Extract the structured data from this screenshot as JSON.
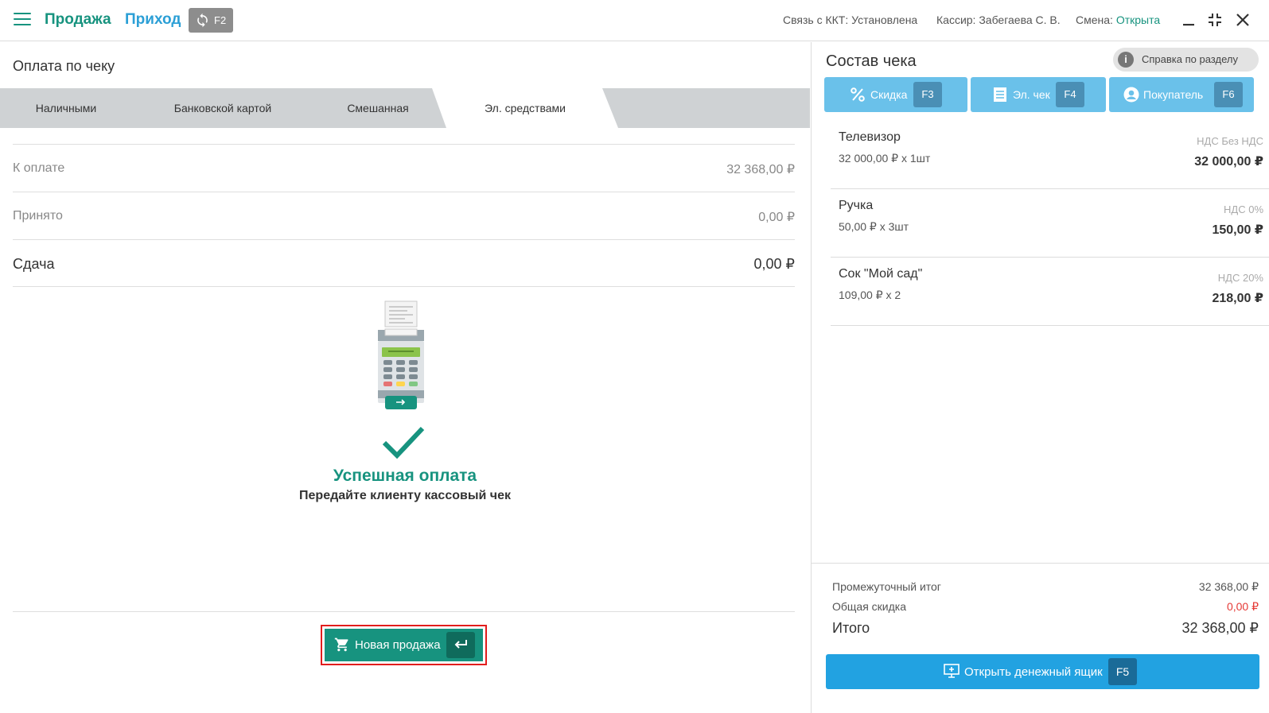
{
  "topbar": {
    "title": "Продажа",
    "subtitle": "Приход",
    "sync_key": "F2",
    "kkt_status": "Связь с ККТ: Установлена",
    "cashier": "Кассир: Забегаева С. В.",
    "shift_label": "Смена:",
    "shift_value": "Открыта"
  },
  "payment": {
    "title": "Оплата по чеку",
    "tabs": [
      "Наличными",
      "Банковской картой",
      "Смешанная",
      "Эл. средствами"
    ],
    "active_tab": 3,
    "rows": [
      {
        "label": "К оплате",
        "value": "32 368,00 ₽"
      },
      {
        "label": "Принято",
        "value": "0,00 ₽"
      },
      {
        "label": "Сдача",
        "value": "0,00 ₽"
      }
    ],
    "success_title": "Успешная оплата",
    "success_sub": "Передайте клиенту кассовый чек",
    "new_sale_label": "Новая продажа"
  },
  "receipt": {
    "title": "Состав чека",
    "help_label": "Справка по разделу",
    "buttons": [
      {
        "label": "Скидка",
        "key": "F3"
      },
      {
        "label": "Эл. чек",
        "key": "F4"
      },
      {
        "label": "Покупатель",
        "key": "F6"
      }
    ],
    "items": [
      {
        "name": "Телевизор",
        "qty": "32 000,00 ₽ х 1шт",
        "vat": "НДС Без НДС",
        "sum": "32 000,00 ₽"
      },
      {
        "name": "Ручка",
        "qty": "50,00 ₽ х 3шт",
        "vat": "НДС 0%",
        "sum": "150,00 ₽"
      },
      {
        "name": "Сок \"Мой сад\"",
        "qty": "109,00 ₽ х 2",
        "vat": "НДС 20%",
        "sum": "218,00 ₽"
      }
    ],
    "subtotal_label": "Промежуточный итог",
    "subtotal_value": "32 368,00 ₽",
    "discount_label": "Общая скидка",
    "discount_value": "0,00 ₽",
    "total_label": "Итого",
    "total_value": "32 368,00 ₽",
    "cash_drawer_label": "Открыть денежный ящик",
    "cash_drawer_key": "F5"
  },
  "colors": {
    "brand_green": "#17937f",
    "accent_blue": "#2b9fd6",
    "button_light_blue": "#6ac1ea",
    "button_blue": "#22a2e1",
    "highlight_red": "#e21d1d"
  },
  "icons": [
    "menu-icon",
    "sync-icon",
    "minimize-icon",
    "collapse-icon",
    "close-icon",
    "cart-icon",
    "enter-icon",
    "info-icon",
    "percent-icon",
    "receipt-icon",
    "user-icon",
    "cash-drawer-icon",
    "payment-terminal-icon",
    "checkmark-icon"
  ]
}
